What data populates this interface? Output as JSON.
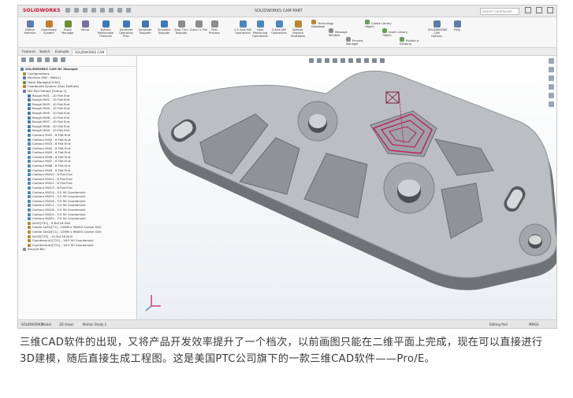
{
  "app": {
    "logo": "SOLIDWORKS",
    "doc_title": "SOLIDWORKS CAM PART",
    "search_placeholder": "Search Commands"
  },
  "ribbon": {
    "items": [
      {
        "label": "Define Machine",
        "color": "#5b7fa6"
      },
      {
        "label": "Coordinate System",
        "color": "#c77b2f"
      },
      {
        "label": "Stock Manager",
        "color": "#6b8e3a"
      },
      {
        "label": "Setup",
        "color": "#7a6fa3"
      },
      {
        "label": "Extract Machinable Features",
        "color": "#3f79b5"
      },
      {
        "label": "Generate Operation Plan",
        "color": "#3f79b5"
      },
      {
        "label": "Generate Toolpath",
        "color": "#3f79b5"
      },
      {
        "label": "Simulate Toolpath",
        "color": "#3f79b5"
      },
      {
        "label": "Step Thru Toolpath",
        "color": "#8c8c8c"
      },
      {
        "label": "Save CL File",
        "color": "#8c8c8c"
      },
      {
        "label": "Post Process",
        "color": "#8c8c8c"
      },
      {
        "label": "2.5 Axis Mill Operations",
        "color": "#4d86bd"
      },
      {
        "label": "Hole Machining Operations",
        "color": "#4d86bd"
      },
      {
        "label": "3 Axis Mill Operations",
        "color": "#4d86bd"
      },
      {
        "label": "Default Feature Strategies",
        "color": "#b58a2f"
      },
      {
        "label": "Technology Database",
        "color": "#b58a2f"
      },
      {
        "label": "Message Window",
        "color": "#8c8c8c"
      },
      {
        "label": "Process Manager",
        "color": "#8c8c8c"
      },
      {
        "label": "Create Library Object",
        "color": "#6a9e57"
      },
      {
        "label": "Insert Library Object",
        "color": "#6a9e57"
      },
      {
        "label": "Publish e-Drawing",
        "color": "#6a9e57"
      },
      {
        "label": "SOLIDWORKS CAM Options",
        "color": "#5b7fa6"
      },
      {
        "label": "Help",
        "color": "#5b7fa6"
      }
    ]
  },
  "tabs": [
    {
      "label": "Features"
    },
    {
      "label": "Sketch"
    },
    {
      "label": "Evaluate"
    },
    {
      "label": "SOLIDWORKS CAM",
      "active": true
    }
  ],
  "tree": {
    "title": "SOLIDWORKS CAM NC Manager",
    "rows": [
      {
        "label": "Configurations",
        "level": 1,
        "color": "#b58a2f"
      },
      {
        "label": "Machine (Mill - Metric)",
        "level": 1,
        "color": "#5b7fa6"
      },
      {
        "label": "Stock Manager[1050]",
        "level": 1,
        "color": "#6b8e3a"
      },
      {
        "label": "Coordinate System (User Defined)",
        "level": 1,
        "color": "#c77b2f"
      },
      {
        "label": "Mill Part Setup1 [Group 1]",
        "level": 1,
        "color": "#7a6fa3"
      },
      {
        "label": "Rough Mill1 - 10 Flat End",
        "level": 2,
        "color": "#3f79b5"
      },
      {
        "label": "Rough Mill2 - 10 Flat End",
        "level": 2,
        "color": "#3f79b5"
      },
      {
        "label": "Rough Mill3 - 10 Flat End",
        "level": 2,
        "color": "#3f79b5"
      },
      {
        "label": "Rough Mill4 - 10 Flat End",
        "level": 2,
        "color": "#3f79b5"
      },
      {
        "label": "Rough Mill5 - 10 Flat End",
        "level": 2,
        "color": "#3f79b5"
      },
      {
        "label": "Rough Mill6 - 10 Flat End",
        "level": 2,
        "color": "#3f79b5"
      },
      {
        "label": "Rough Mill7 - 10 Flat End",
        "level": 2,
        "color": "#3f79b5"
      },
      {
        "label": "Rough Mill8 - 10 Flat End",
        "level": 2,
        "color": "#3f79b5"
      },
      {
        "label": "Rough Mill9 - 10 Flat End",
        "level": 2,
        "color": "#3f79b5"
      },
      {
        "label": "Contour Mill1 - 6 Flat End",
        "level": 2,
        "color": "#4d86bd"
      },
      {
        "label": "Contour Mill2 - 6 Flat End",
        "level": 2,
        "color": "#4d86bd"
      },
      {
        "label": "Contour Mill3 - 6 Flat End",
        "level": 2,
        "color": "#4d86bd"
      },
      {
        "label": "Contour Mill4 - 6 Flat End",
        "level": 2,
        "color": "#4d86bd"
      },
      {
        "label": "Contour Mill5 - 6 Flat End",
        "level": 2,
        "color": "#4d86bd"
      },
      {
        "label": "Contour Mill6 - 6 Flat End",
        "level": 2,
        "color": "#4d86bd"
      },
      {
        "label": "Contour Mill7 - 6 Flat End",
        "level": 2,
        "color": "#4d86bd"
      },
      {
        "label": "Contour Mill8 - 6 Flat End",
        "level": 2,
        "color": "#4d86bd"
      },
      {
        "label": "Contour Mill9 - 6 Flat End",
        "level": 2,
        "color": "#4d86bd"
      },
      {
        "label": "Contour Mill10 - 6 Flat End",
        "level": 2,
        "color": "#4d86bd"
      },
      {
        "label": "Contour Mill11 - 6 Flat End",
        "level": 2,
        "color": "#4d86bd"
      },
      {
        "label": "Contour Mill12 - 6 Flat End",
        "level": 2,
        "color": "#4d86bd"
      },
      {
        "label": "Contour Mill13 - 6 Flat End",
        "level": 2,
        "color": "#4d86bd"
      },
      {
        "label": "Contour Mill14 - 3.5 90 Countersink",
        "level": 2,
        "color": "#4d86bd"
      },
      {
        "label": "Contour Mill15 - 3.5 90 Countersink",
        "level": 2,
        "color": "#4d86bd"
      },
      {
        "label": "Contour Mill16 - 3.5 90 Countersink",
        "level": 2,
        "color": "#4d86bd"
      },
      {
        "label": "Contour Mill17 - 3.5 90 Countersink",
        "level": 2,
        "color": "#4d86bd"
      },
      {
        "label": "Contour Mill18 - 3.5 90 Countersink",
        "level": 2,
        "color": "#4d86bd"
      },
      {
        "label": "Contour Mill19 - 3.5 90 Countersink",
        "level": 2,
        "color": "#4d86bd"
      },
      {
        "label": "Contour Mill20 - 3.5 90 Countersink",
        "level": 2,
        "color": "#4d86bd"
      },
      {
        "label": "Drill1[T22] - 8.8x118 Drill",
        "level": 2,
        "color": "#b58a2f"
      },
      {
        "label": "Center Drill1[T1] - 10MM x 90DEG Center Drill",
        "level": 2,
        "color": "#b58a2f"
      },
      {
        "label": "Center Drill2[T1] - 10MM x 90DEG Center Drill",
        "level": 2,
        "color": "#b58a2f"
      },
      {
        "label": "Drill2[T23] - 10.5x118 Drill",
        "level": 2,
        "color": "#b58a2f"
      },
      {
        "label": "Countersink1[T21] - 16.5 90 Countersink",
        "level": 2,
        "color": "#b58a2f"
      },
      {
        "label": "Countersink2[T21] - 16.5 90 Countersink",
        "level": 2,
        "color": "#b58a2f"
      },
      {
        "label": "Recycle Bin",
        "level": 1,
        "color": "#8c8c8c"
      }
    ]
  },
  "statusbar": {
    "left": "SOLIDWORKS",
    "tabs": [
      "Model",
      "3D Views",
      "Motion Study 1"
    ],
    "right_status": "Editing Part",
    "units": "MMGS"
  },
  "caption": "三维CAD软件的出现，又将产品开发效率提升了一个档次，以前画图只能在二维平面上完成，现在可以直接进行3D建模，随后直接生成工程图。这是美国PTC公司旗下的一款三维CAD软件——Pro/E。",
  "colors": {
    "part_top": "#bcbfc2",
    "part_side": "#6f7377",
    "toolpath": "#c2185b"
  },
  "icons": {
    "triad": "coordinate-triad-icon",
    "tool": "tool-icon"
  }
}
